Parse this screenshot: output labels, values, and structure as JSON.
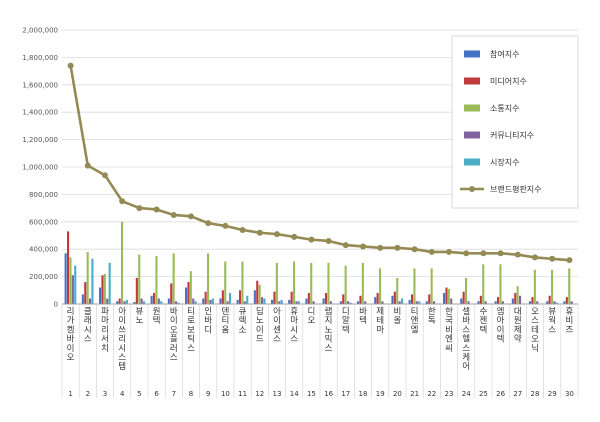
{
  "chart_data": {
    "type": "bar",
    "ylim": [
      0,
      2000000
    ],
    "yticks": [
      "0",
      "200,000",
      "400,000",
      "600,000",
      "800,000",
      "1,000,000",
      "1,200,000",
      "1,400,000",
      "1,600,000",
      "1,800,000",
      "2,000,000"
    ],
    "grid": true,
    "legend_position": "top-right",
    "categories": [
      "리가켐바이오",
      "클래시스",
      "파마리서치",
      "아이쓰리시스템",
      "뷰노",
      "원텍",
      "바이오플러스",
      "티로보틱스",
      "인바디",
      "덴티움",
      "큐렉소",
      "딥노이드",
      "아이센스",
      "휴마시스",
      "디오",
      "랩지노믹스",
      "디알텍",
      "바텍",
      "제테마",
      "비올",
      "티앤엘",
      "한독",
      "한국비엔씨",
      "셀바스헬스케어",
      "수젠텍",
      "엠아이텍",
      "대원제약",
      "오스테오닉",
      "뷰웍스",
      "휴비즈"
    ],
    "indices": [
      "1",
      "2",
      "3",
      "4",
      "5",
      "6",
      "7",
      "8",
      "9",
      "10",
      "11",
      "12",
      "13",
      "14",
      "15",
      "16",
      "17",
      "18",
      "19",
      "20",
      "21",
      "22",
      "23",
      "24",
      "25",
      "26",
      "27",
      "28",
      "29",
      "30"
    ],
    "series": [
      {
        "name": "참여지수",
        "kind": "bar",
        "color": "#4472c4",
        "values": [
          370000,
          70000,
          120000,
          20000,
          15000,
          60000,
          40000,
          120000,
          40000,
          40000,
          30000,
          100000,
          30000,
          30000,
          40000,
          40000,
          20000,
          20000,
          50000,
          60000,
          30000,
          20000,
          80000,
          40000,
          20000,
          20000,
          40000,
          20000,
          20000,
          20000
        ]
      },
      {
        "name": "미디어지수",
        "kind": "bar",
        "color": "#c0393b",
        "values": [
          530000,
          160000,
          210000,
          40000,
          190000,
          80000,
          150000,
          160000,
          90000,
          100000,
          100000,
          170000,
          90000,
          90000,
          80000,
          80000,
          70000,
          60000,
          80000,
          90000,
          70000,
          70000,
          120000,
          90000,
          60000,
          50000,
          80000,
          50000,
          60000,
          50000
        ]
      },
      {
        "name": "소통지수",
        "kind": "bar",
        "color": "#9bbb59",
        "values": [
          340000,
          380000,
          220000,
          600000,
          360000,
          350000,
          370000,
          240000,
          370000,
          310000,
          310000,
          140000,
          300000,
          310000,
          300000,
          300000,
          280000,
          300000,
          260000,
          190000,
          260000,
          260000,
          110000,
          190000,
          290000,
          290000,
          130000,
          250000,
          250000,
          260000
        ]
      },
      {
        "name": "커뮤니티지수",
        "kind": "bar",
        "color": "#8064a2",
        "values": [
          210000,
          40000,
          40000,
          20000,
          40000,
          40000,
          20000,
          40000,
          30000,
          20000,
          20000,
          50000,
          20000,
          20000,
          20000,
          20000,
          20000,
          20000,
          20000,
          20000,
          20000,
          20000,
          40000,
          20000,
          20000,
          20000,
          60000,
          20000,
          20000,
          20000
        ]
      },
      {
        "name": "시장지수",
        "kind": "bar",
        "color": "#4bacc6",
        "values": [
          280000,
          330000,
          300000,
          30000,
          20000,
          20000,
          10000,
          20000,
          40000,
          80000,
          60000,
          40000,
          30000,
          20000,
          0,
          0,
          10000,
          0,
          0,
          40000,
          20000,
          0,
          0,
          0,
          0,
          0,
          0,
          0,
          10000,
          0
        ]
      },
      {
        "name": "브랜드평판지수",
        "kind": "line",
        "color": "#948a54",
        "values": [
          1740000,
          1010000,
          940000,
          750000,
          700000,
          690000,
          650000,
          640000,
          590000,
          570000,
          540000,
          520000,
          510000,
          490000,
          470000,
          460000,
          430000,
          420000,
          410000,
          410000,
          400000,
          380000,
          380000,
          370000,
          370000,
          370000,
          360000,
          340000,
          330000,
          320000
        ]
      }
    ]
  }
}
